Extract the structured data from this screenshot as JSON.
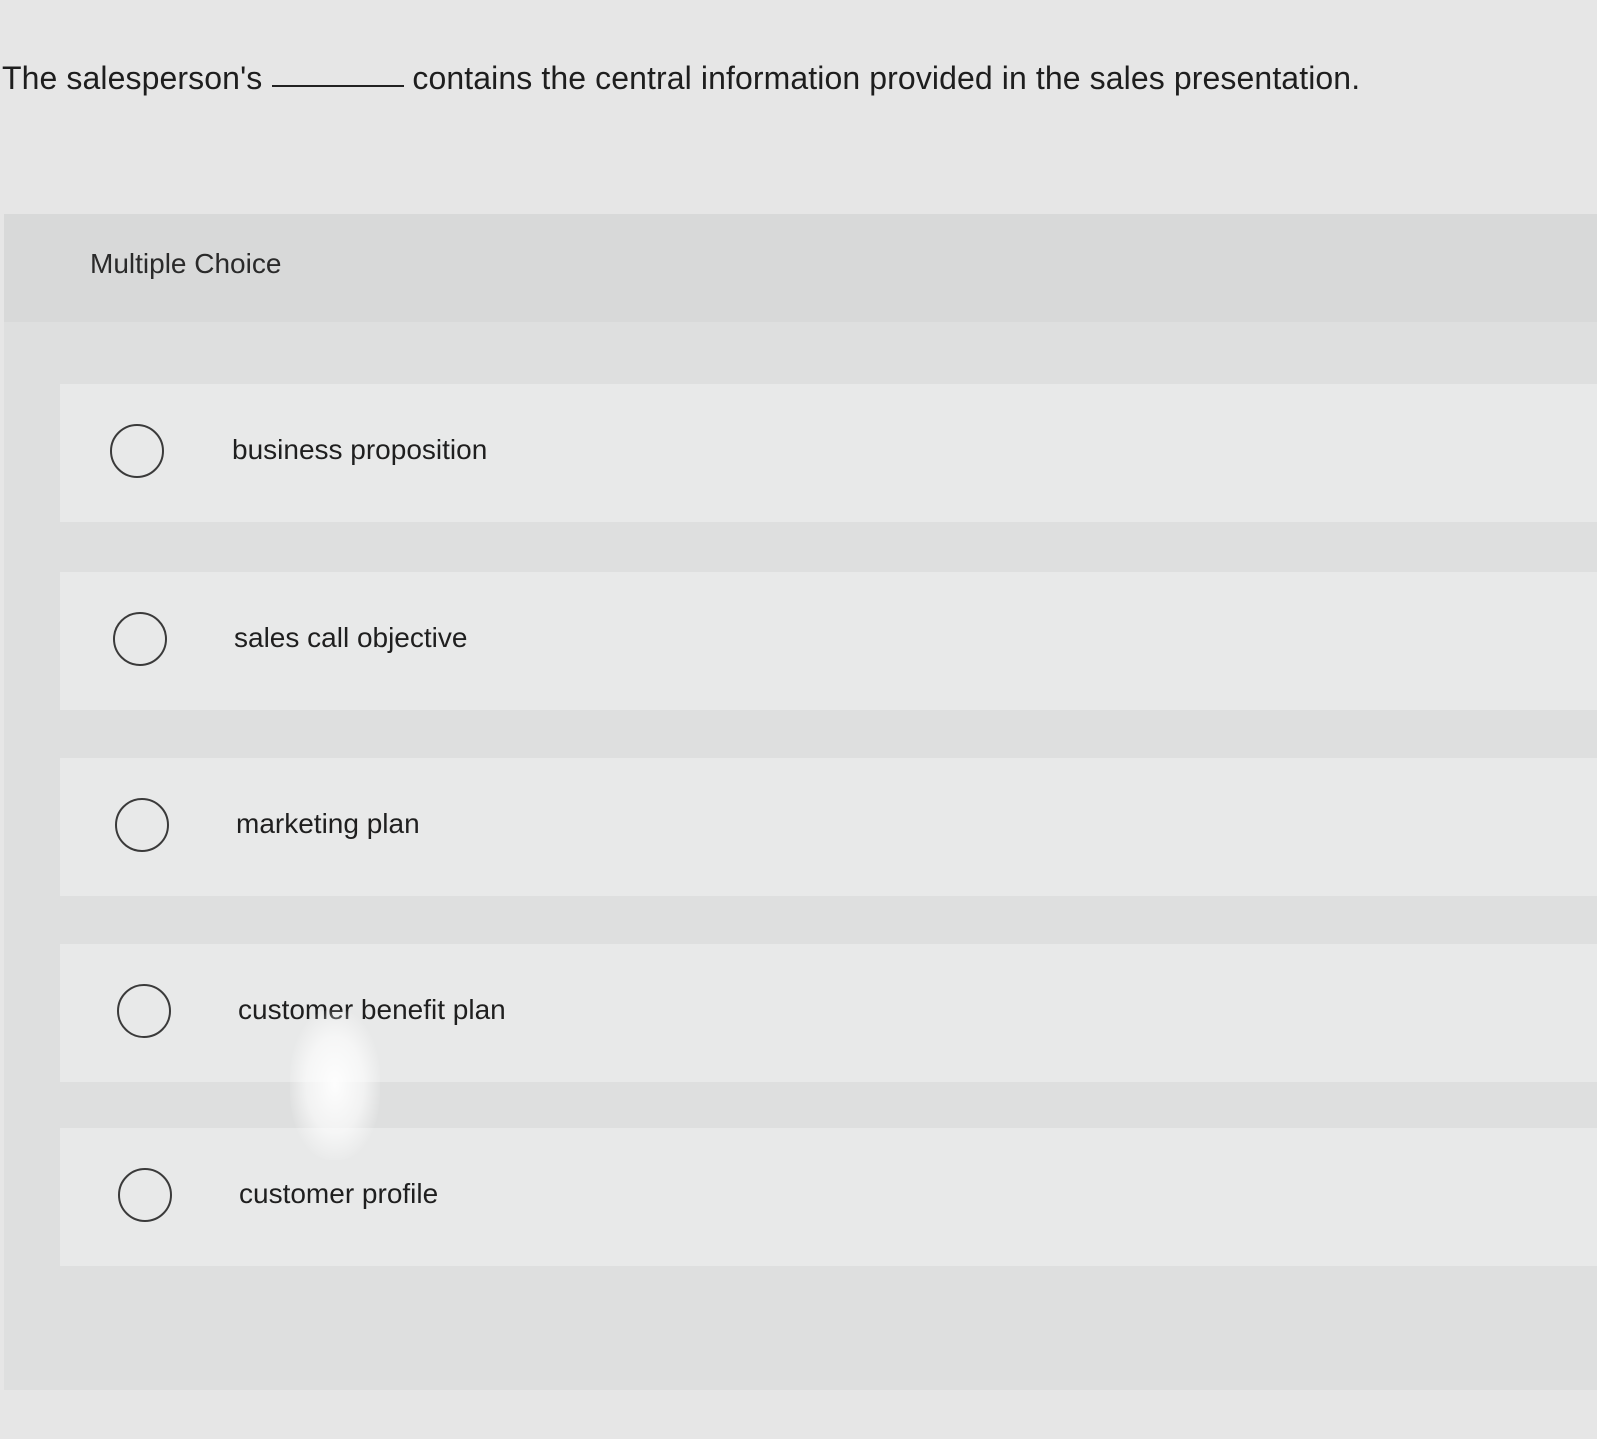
{
  "question": {
    "before_blank": "The salesperson's",
    "after_blank": "contains the central information provided in the sales presentation."
  },
  "multiple_choice": {
    "label": "Multiple Choice",
    "options": [
      {
        "label": "business proposition",
        "selected": false
      },
      {
        "label": "sales call objective",
        "selected": false
      },
      {
        "label": "marketing plan",
        "selected": false
      },
      {
        "label": "customer benefit plan",
        "selected": false
      },
      {
        "label": "customer profile",
        "selected": false
      }
    ]
  }
}
